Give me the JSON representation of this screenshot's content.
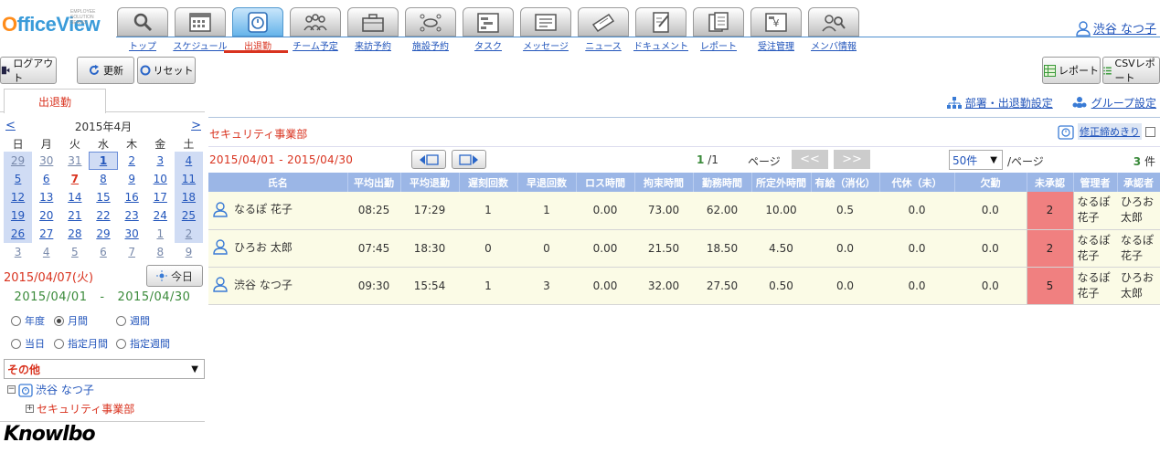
{
  "app": {
    "logo_lead": "O",
    "logo_rest": "fficeView",
    "logo_tagline": "EMPLOYEE SOLUTION SERIES",
    "user_name": "渋谷 なつ子"
  },
  "nav": [
    {
      "label": "トップ",
      "icon": "search-icon"
    },
    {
      "label": "スケジュール",
      "icon": "calendar-icon"
    },
    {
      "label": "出退勤",
      "icon": "timecard-icon"
    },
    {
      "label": "チーム予定",
      "icon": "team-icon"
    },
    {
      "label": "来訪予約",
      "icon": "briefcase-icon"
    },
    {
      "label": "施設予約",
      "icon": "meeting-room-icon"
    },
    {
      "label": "タスク",
      "icon": "task-icon"
    },
    {
      "label": "メッセージ",
      "icon": "message-icon"
    },
    {
      "label": "ニュース",
      "icon": "news-icon"
    },
    {
      "label": "ドキュメント",
      "icon": "document-icon"
    },
    {
      "label": "レポート",
      "icon": "report-icon"
    },
    {
      "label": "受注管理",
      "icon": "register-icon"
    },
    {
      "label": "メンバ情報",
      "icon": "member-search-icon"
    }
  ],
  "active_nav": "出退勤",
  "toolbar": {
    "logout": "ログアウト",
    "refresh": "更新",
    "reset": "リセット",
    "report": "レポート",
    "csv_report": "CSVレポート"
  },
  "sidebar": {
    "tab": "出退勤",
    "calendar": {
      "prev": "<",
      "next": ">",
      "title": "2015年4月",
      "weekdays": [
        "日",
        "月",
        "火",
        "水",
        "木",
        "金",
        "土"
      ],
      "weeks": [
        [
          "29",
          "30",
          "31",
          "1",
          "2",
          "3",
          "4"
        ],
        [
          "5",
          "6",
          "7",
          "8",
          "9",
          "10",
          "11"
        ],
        [
          "12",
          "13",
          "14",
          "15",
          "16",
          "17",
          "18"
        ],
        [
          "19",
          "20",
          "21",
          "22",
          "23",
          "24",
          "25"
        ],
        [
          "26",
          "27",
          "28",
          "29",
          "30",
          "1",
          "2"
        ],
        [
          "3",
          "4",
          "5",
          "6",
          "7",
          "8",
          "9"
        ]
      ]
    },
    "selected_date": "2015/04/07(火)",
    "today_button": "今日",
    "range_from": "2015/04/01",
    "range_sep": "-",
    "range_to": "2015/04/30",
    "period_options": [
      {
        "label": "年度",
        "checked": false
      },
      {
        "label": "月間",
        "checked": true
      },
      {
        "label": "週間",
        "checked": false
      },
      {
        "label": "当日",
        "checked": false
      },
      {
        "label": "指定月間",
        "checked": false
      },
      {
        "label": "指定週間",
        "checked": false
      }
    ],
    "group_select": "その他",
    "tree_user": "渋谷 なつ子",
    "tree_dept": "セキュリティ事業部",
    "footer_logo": "Knowlbo"
  },
  "main": {
    "dept_settings": "部署・出退勤設定",
    "group_settings": "グループ設定",
    "department": "セキュリティ事業部",
    "lock_label": "修正締めきり",
    "period": "2015/04/01 - 2015/04/30",
    "pager": {
      "current": "1",
      "total_pages": "/1",
      "label": "ページ",
      "first": "<<",
      "last": ">>",
      "per_page": "50件",
      "per_page_suffix": "/ページ",
      "count": "3",
      "count_unit": "件"
    },
    "columns": [
      "氏名",
      "平均出勤",
      "平均退勤",
      "遅刻回数",
      "早退回数",
      "ロス時間",
      "拘束時間",
      "勤務時間",
      "所定外時間",
      "有給（消化）",
      "代休（未）",
      "欠勤",
      "未承認",
      "管理者",
      "承認者"
    ],
    "rows": [
      {
        "name": "なるぽ 花子",
        "in": "08:25",
        "out": "17:29",
        "late": "1",
        "early": "1",
        "loss": "0.00",
        "bound": "73.00",
        "work": "62.00",
        "overtime": "10.00",
        "paid": "0.5",
        "comp": "0.0",
        "absent": "0.0",
        "pending": "2",
        "manager": "なるぽ花子",
        "approver": "ひろお太郎"
      },
      {
        "name": "ひろお 太郎",
        "in": "07:45",
        "out": "18:30",
        "late": "0",
        "early": "0",
        "loss": "0.00",
        "bound": "21.50",
        "work": "18.50",
        "overtime": "4.50",
        "paid": "0.0",
        "comp": "0.0",
        "absent": "0.0",
        "pending": "2",
        "manager": "なるぽ花子",
        "approver": "なるぽ花子"
      },
      {
        "name": "渋谷 なつ子",
        "in": "09:30",
        "out": "15:54",
        "late": "1",
        "early": "3",
        "loss": "0.00",
        "bound": "32.00",
        "work": "27.50",
        "overtime": "0.50",
        "paid": "0.0",
        "comp": "0.0",
        "absent": "0.0",
        "pending": "5",
        "manager": "なるぽ花子",
        "approver": "ひろお太郎"
      }
    ]
  },
  "colors": {
    "accent_red": "#d9331f",
    "link_blue": "#2255bb",
    "header_blue": "#9bb6e6",
    "row_bg": "#fbfbe6",
    "pending_red": "#f08080",
    "green": "#3a8a3a"
  }
}
